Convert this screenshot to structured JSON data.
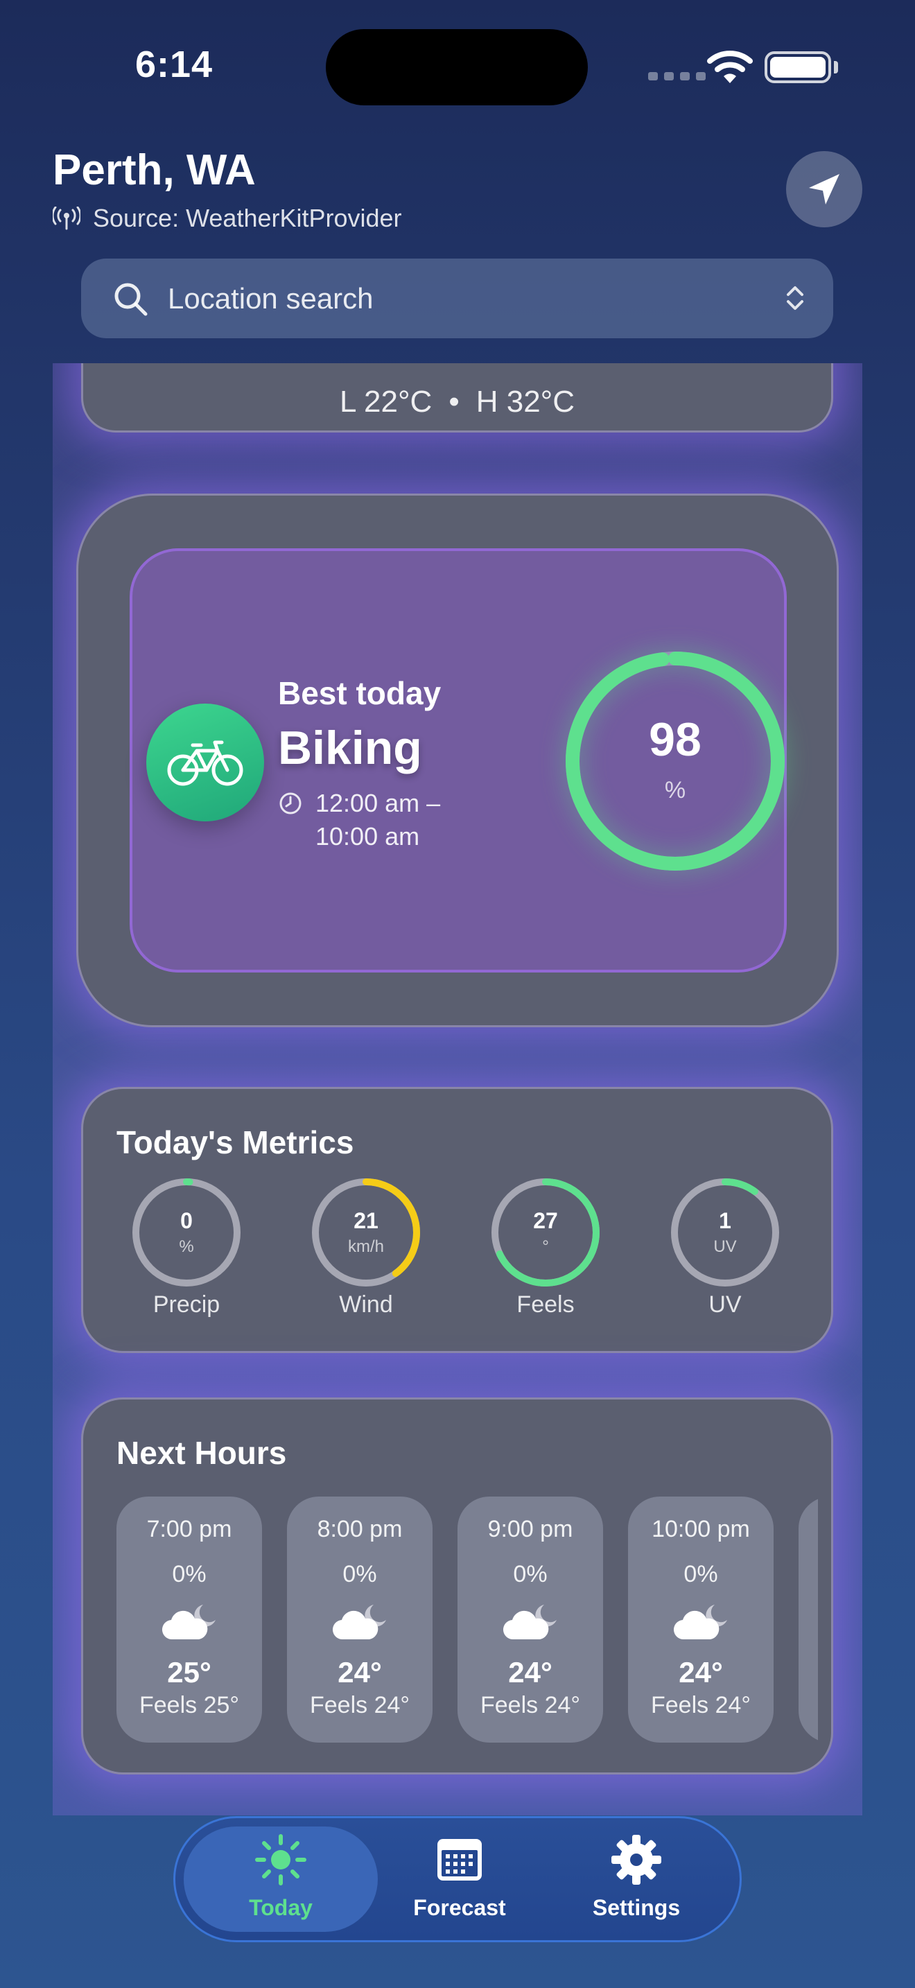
{
  "status_bar": {
    "time": "6:14"
  },
  "header": {
    "city": "Perth, WA",
    "source": "Source: WeatherKitProvider"
  },
  "search": {
    "placeholder": "Location search"
  },
  "temp_card": {
    "low": "L 22°C",
    "separator": "•",
    "high": "H 32°C"
  },
  "best_today": {
    "label": "Best today",
    "activity": "Biking",
    "time_line1": "12:00 am –",
    "time_line2": "10:00 am",
    "score": "98",
    "score_unit": "%",
    "score_fraction": 0.98,
    "accent": "#5ee08e"
  },
  "metrics": {
    "title": "Today's Metrics",
    "items": [
      {
        "value": "0",
        "unit": "%",
        "label": "Precip",
        "fraction": 0.01,
        "color": "#5ee08e"
      },
      {
        "value": "21",
        "unit": "km/h",
        "label": "Wind",
        "fraction": 0.4,
        "color": "#f5cc17"
      },
      {
        "value": "27",
        "unit": "°",
        "label": "Feels",
        "fraction": 0.68,
        "color": "#5ee08e"
      },
      {
        "value": "1",
        "unit": "UV",
        "label": "UV",
        "fraction": 0.1,
        "color": "#5ee08e"
      }
    ]
  },
  "next_hours": {
    "title": "Next Hours",
    "hours": [
      {
        "time": "7:00 pm",
        "precip": "0%",
        "icon": "partly-cloudy-night-icon",
        "temp": "25°",
        "feels": "Feels 25°"
      },
      {
        "time": "8:00 pm",
        "precip": "0%",
        "icon": "partly-cloudy-night-icon",
        "temp": "24°",
        "feels": "Feels 24°"
      },
      {
        "time": "9:00 pm",
        "precip": "0%",
        "icon": "partly-cloudy-night-icon",
        "temp": "24°",
        "feels": "Feels 24°"
      },
      {
        "time": "10:00 pm",
        "precip": "0%",
        "icon": "partly-cloudy-night-icon",
        "temp": "24°",
        "feels": "Feels 24°"
      }
    ]
  },
  "tabs": [
    {
      "label": "Today",
      "icon": "sun-icon",
      "selected": true,
      "color": "#5ee08e"
    },
    {
      "label": "Forecast",
      "icon": "calendar-icon",
      "selected": false,
      "color": "#ffffff"
    },
    {
      "label": "Settings",
      "icon": "gear-icon",
      "selected": false,
      "color": "#ffffff"
    }
  ]
}
